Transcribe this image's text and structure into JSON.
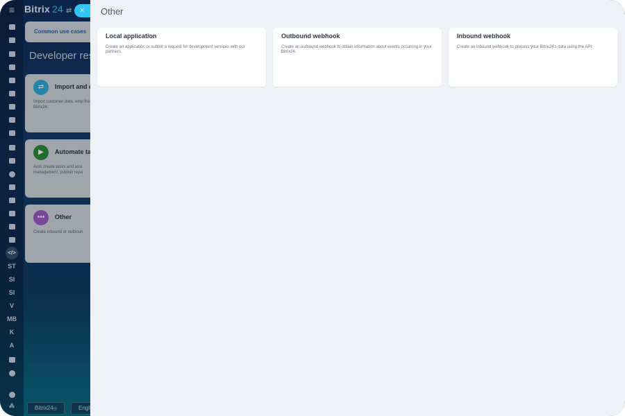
{
  "app": {
    "logo_name": "Bitrix",
    "logo_number": "24",
    "close_label": "×"
  },
  "background": {
    "tab_label": "Common use cases",
    "heading": "Developer reso",
    "cards": [
      {
        "title": "Import and e",
        "desc": "Import customer data, emp from your Bitrix24.",
        "icon": "swap-arrows-icon",
        "color": "#2fa8d8"
      },
      {
        "title": "Automate ta",
        "desc": "Auto create tasks and assi management; publish repo",
        "icon": "play-icon",
        "color": "#2e8b3b"
      },
      {
        "title": "Other",
        "desc": "Create inbound or outboun",
        "icon": "more-dots-icon",
        "color": "#9b5bbf"
      }
    ],
    "footer_logo": "Bitrix24",
    "footer_language": "Engli"
  },
  "rail": {
    "letter_items": [
      "ST",
      "SI",
      "SI",
      "V",
      "MB",
      "K",
      "A"
    ]
  },
  "panel": {
    "title": "Other",
    "cards": [
      {
        "title": "Local application",
        "desc": "Create an application or submit a request for development services with our partners."
      },
      {
        "title": "Outbound webhook",
        "desc": "Create an outbound webhook to obtain information about events occurring in your Bitrix24."
      },
      {
        "title": "Inbound webhook",
        "desc": "Create an inbound webhook to process your Bitrix24's data using the API."
      }
    ]
  },
  "colors": {
    "accent": "#2fc6f6",
    "panel_bg": "#eef2f6"
  }
}
